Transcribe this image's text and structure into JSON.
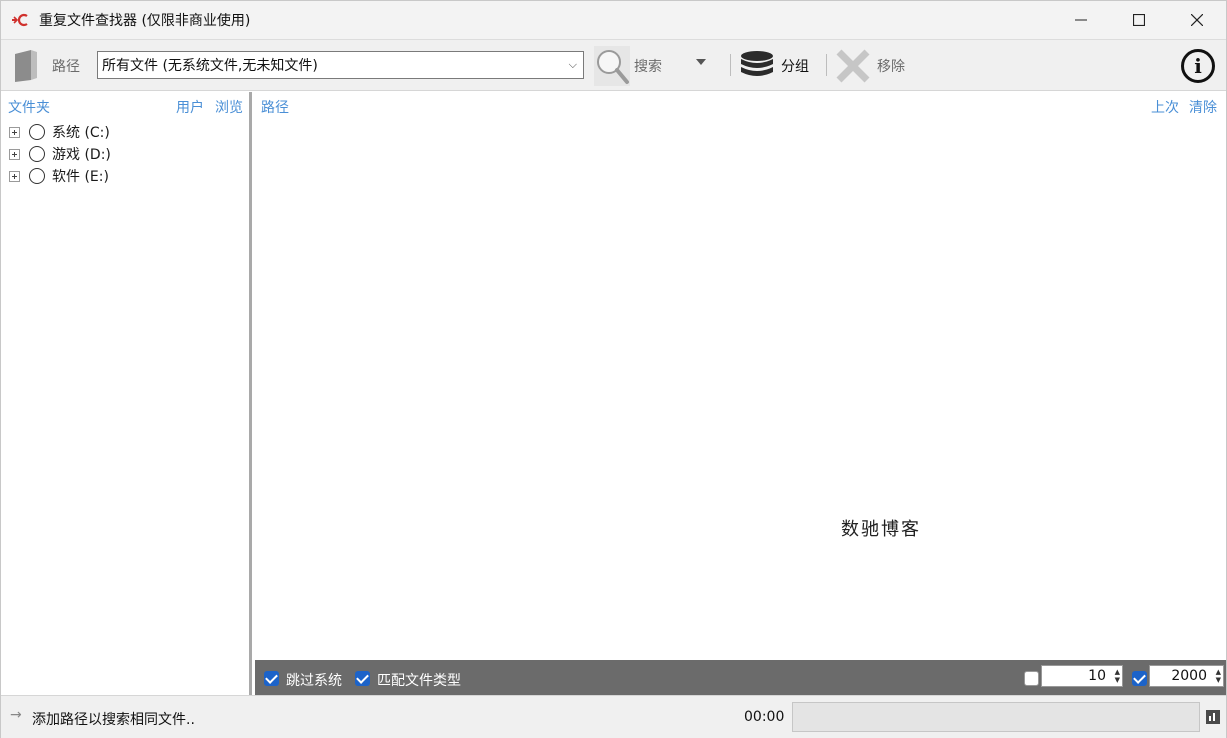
{
  "window": {
    "title": "重复文件查找器 (仅限非商业使用)",
    "app_icon": "red-arrow-c-icon",
    "minimize_icon": "minimize-icon",
    "maximize_icon": "maximize-icon",
    "close_icon": "close-icon"
  },
  "toolbar": {
    "path_label": "路径",
    "file_filter_value": "所有文件 (无系统文件,无未知文件)",
    "search_label": "搜索",
    "group_label": "分组",
    "remove_label": "移除",
    "icons": [
      "folder-icon",
      "search-magnifier-icon",
      "chevron-down-icon",
      "database-icon",
      "x-remove-icon",
      "info-icon"
    ]
  },
  "left_panel": {
    "header_title": "文件夹",
    "link_user": "用户",
    "link_browse": "浏览",
    "drives": [
      {
        "label": "系统 (C:)"
      },
      {
        "label": "游戏 (D:)"
      },
      {
        "label": "软件 (E:)"
      }
    ]
  },
  "right_panel": {
    "header_title": "路径",
    "link_last": "上次",
    "link_clear": "清除",
    "watermark": "数驰博客"
  },
  "options": {
    "skip_system_label": "跳过系统",
    "skip_system_checked": true,
    "match_type_label": "匹配文件类型",
    "match_type_checked": true,
    "min_size_checked": false,
    "min_size_value": "10",
    "max_count_checked": true,
    "max_count_value": "2000"
  },
  "status": {
    "message": "添加路径以搜索相同文件..",
    "time": "00:00",
    "progress": 0
  },
  "colors": {
    "accent_link": "#4a8fd6",
    "options_bar_bg": "#6b6b6b",
    "checkbox_on": "#1c63c9",
    "app_icon_red": "#d0312d"
  }
}
